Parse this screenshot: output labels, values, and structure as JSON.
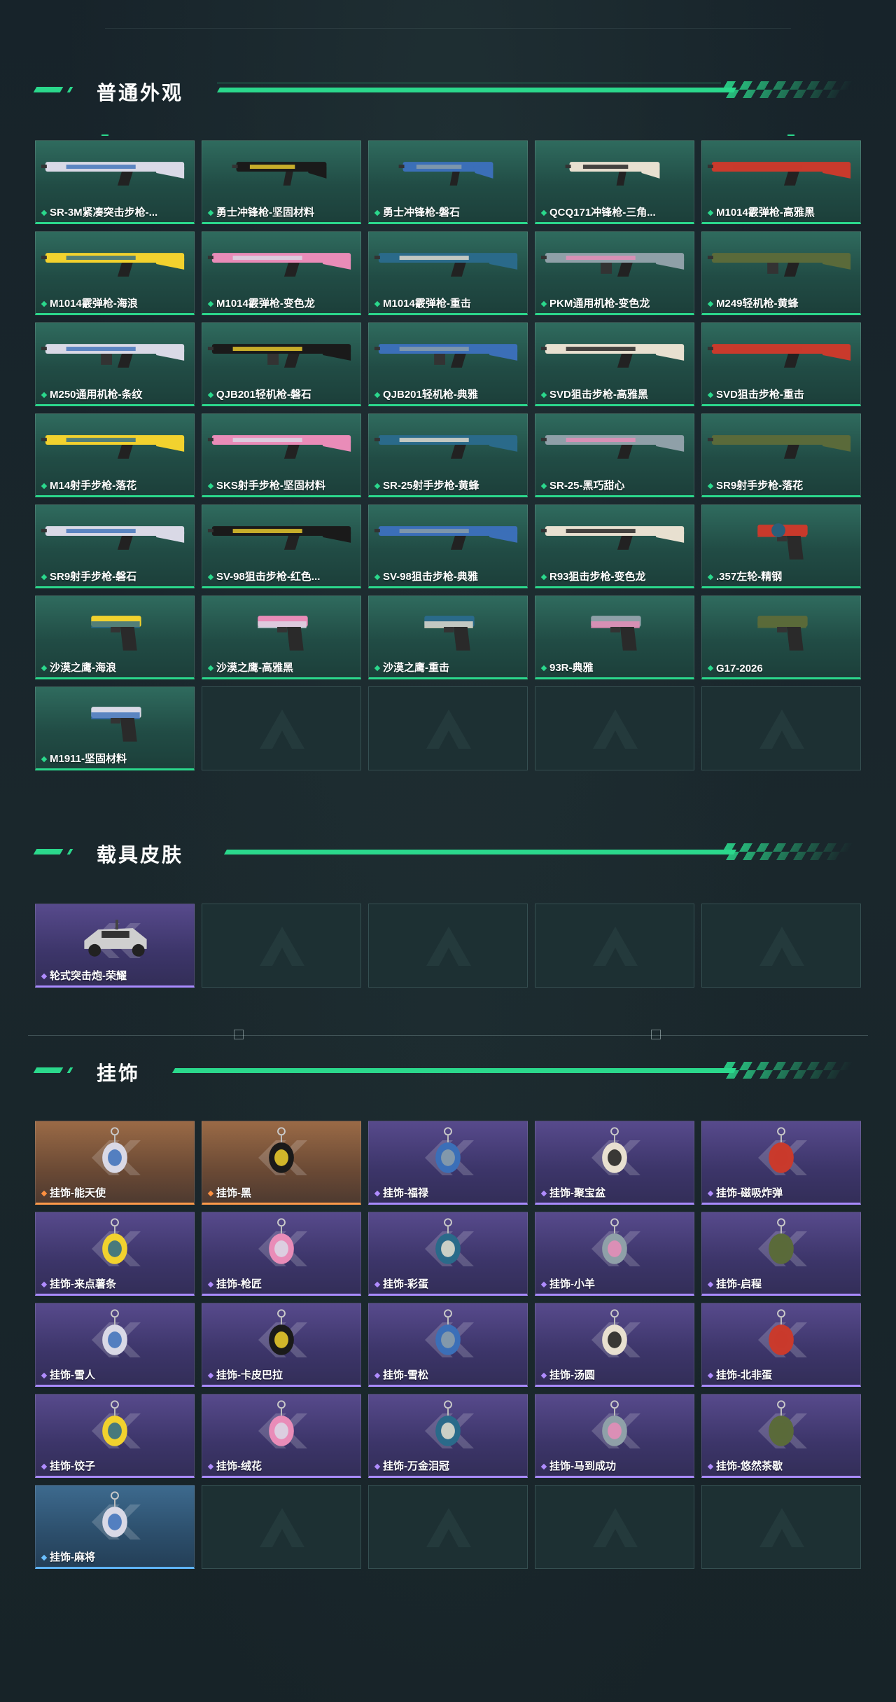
{
  "colors": {
    "accent_green": "#2bd88c",
    "rarity_purple": "#a98bff",
    "rarity_orange": "#ff9a4a",
    "rarity_blue": "#5fb4ff"
  },
  "sections": {
    "appearance": {
      "title": "普通外观",
      "items": [
        {
          "label": "SR-3M紧凑突击步枪-...",
          "rarity": "green",
          "icon": "rifle-icon"
        },
        {
          "label": "勇士冲锋枪-坚固材料",
          "rarity": "green",
          "icon": "smg-icon"
        },
        {
          "label": "勇士冲锋枪-磐石",
          "rarity": "green",
          "icon": "smg-icon"
        },
        {
          "label": "QCQ171冲锋枪-三角...",
          "rarity": "green",
          "icon": "smg-icon"
        },
        {
          "label": "M1014霰弹枪-高雅黑",
          "rarity": "green",
          "icon": "shotgun-icon"
        },
        {
          "label": "M1014霰弹枪-海浪",
          "rarity": "green",
          "icon": "shotgun-icon"
        },
        {
          "label": "M1014霰弹枪-变色龙",
          "rarity": "green",
          "icon": "shotgun-icon"
        },
        {
          "label": "M1014霰弹枪-重击",
          "rarity": "green",
          "icon": "shotgun-icon"
        },
        {
          "label": "PKM通用机枪-变色龙",
          "rarity": "green",
          "icon": "machine-gun-icon"
        },
        {
          "label": "M249轻机枪-黄蜂",
          "rarity": "green",
          "icon": "machine-gun-icon"
        },
        {
          "label": "M250通用机枪-条纹",
          "rarity": "green",
          "icon": "machine-gun-icon"
        },
        {
          "label": "QJB201轻机枪-磐石",
          "rarity": "green",
          "icon": "machine-gun-icon"
        },
        {
          "label": "QJB201轻机枪-典雅",
          "rarity": "green",
          "icon": "machine-gun-icon"
        },
        {
          "label": "SVD狙击步枪-高雅黑",
          "rarity": "green",
          "icon": "sniper-icon"
        },
        {
          "label": "SVD狙击步枪-重击",
          "rarity": "green",
          "icon": "sniper-icon"
        },
        {
          "label": "M14射手步枪-落花",
          "rarity": "green",
          "icon": "marksman-rifle-icon"
        },
        {
          "label": "SKS射手步枪-坚固材料",
          "rarity": "green",
          "icon": "marksman-rifle-icon"
        },
        {
          "label": "SR-25射手步枪-黄蜂",
          "rarity": "green",
          "icon": "marksman-rifle-icon"
        },
        {
          "label": "SR-25-黑巧甜心",
          "rarity": "green",
          "icon": "marksman-rifle-icon"
        },
        {
          "label": "SR9射手步枪-落花",
          "rarity": "green",
          "icon": "marksman-rifle-icon"
        },
        {
          "label": "SR9射手步枪-磐石",
          "rarity": "green",
          "icon": "marksman-rifle-icon"
        },
        {
          "label": "SV-98狙击步枪-红色...",
          "rarity": "green",
          "icon": "sniper-icon"
        },
        {
          "label": "SV-98狙击步枪-典雅",
          "rarity": "green",
          "icon": "sniper-icon"
        },
        {
          "label": "R93狙击步枪-变色龙",
          "rarity": "green",
          "icon": "sniper-icon"
        },
        {
          "label": ".357左轮-精钢",
          "rarity": "green",
          "icon": "revolver-icon"
        },
        {
          "label": "沙漠之鹰-海浪",
          "rarity": "green",
          "icon": "pistol-icon"
        },
        {
          "label": "沙漠之鹰-高雅黑",
          "rarity": "green",
          "icon": "pistol-icon"
        },
        {
          "label": "沙漠之鹰-重击",
          "rarity": "green",
          "icon": "pistol-icon"
        },
        {
          "label": "93R-典雅",
          "rarity": "green",
          "icon": "pistol-icon"
        },
        {
          "label": "G17-2026",
          "rarity": "green",
          "icon": "pistol-icon"
        },
        {
          "label": "M1911-坚固材料",
          "rarity": "green",
          "icon": "pistol-icon"
        }
      ],
      "empty_slots": 4
    },
    "vehicle": {
      "title": "载具皮肤",
      "items": [
        {
          "label": "轮式突击炮-荣耀",
          "rarity": "purple",
          "icon": "vehicle-icon"
        }
      ],
      "empty_slots": 4
    },
    "charms": {
      "title": "挂饰",
      "items": [
        {
          "label": "挂饰-能天使",
          "rarity": "orange",
          "icon": "charm-icon"
        },
        {
          "label": "挂饰-黑",
          "rarity": "orange",
          "icon": "charm-icon"
        },
        {
          "label": "挂饰-福禄",
          "rarity": "purple",
          "icon": "charm-icon"
        },
        {
          "label": "挂饰-聚宝盆",
          "rarity": "purple",
          "icon": "charm-icon"
        },
        {
          "label": "挂饰-磁吸炸弹",
          "rarity": "purple",
          "icon": "charm-icon"
        },
        {
          "label": "挂饰-来点薯条",
          "rarity": "purple",
          "icon": "charm-icon"
        },
        {
          "label": "挂饰-枪匠",
          "rarity": "purple",
          "icon": "charm-icon"
        },
        {
          "label": "挂饰-彩蛋",
          "rarity": "purple",
          "icon": "charm-icon"
        },
        {
          "label": "挂饰-小羊",
          "rarity": "purple",
          "icon": "charm-icon"
        },
        {
          "label": "挂饰-启程",
          "rarity": "purple",
          "icon": "charm-icon"
        },
        {
          "label": "挂饰-雪人",
          "rarity": "purple",
          "icon": "charm-icon"
        },
        {
          "label": "挂饰-卡皮巴拉",
          "rarity": "purple",
          "icon": "charm-icon"
        },
        {
          "label": "挂饰-雪松",
          "rarity": "purple",
          "icon": "charm-icon"
        },
        {
          "label": "挂饰-汤圆",
          "rarity": "purple",
          "icon": "charm-icon"
        },
        {
          "label": "挂饰-北非蛋",
          "rarity": "purple",
          "icon": "charm-icon"
        },
        {
          "label": "挂饰-饺子",
          "rarity": "purple",
          "icon": "charm-icon"
        },
        {
          "label": "挂饰-绒花",
          "rarity": "purple",
          "icon": "charm-icon"
        },
        {
          "label": "挂饰-万金泪冠",
          "rarity": "purple",
          "icon": "charm-icon"
        },
        {
          "label": "挂饰-马到成功",
          "rarity": "purple",
          "icon": "charm-icon"
        },
        {
          "label": "挂饰-悠然茶歇",
          "rarity": "purple",
          "icon": "charm-icon"
        },
        {
          "label": "挂饰-麻将",
          "rarity": "blue",
          "icon": "charm-icon"
        }
      ],
      "empty_slots": 4
    }
  }
}
